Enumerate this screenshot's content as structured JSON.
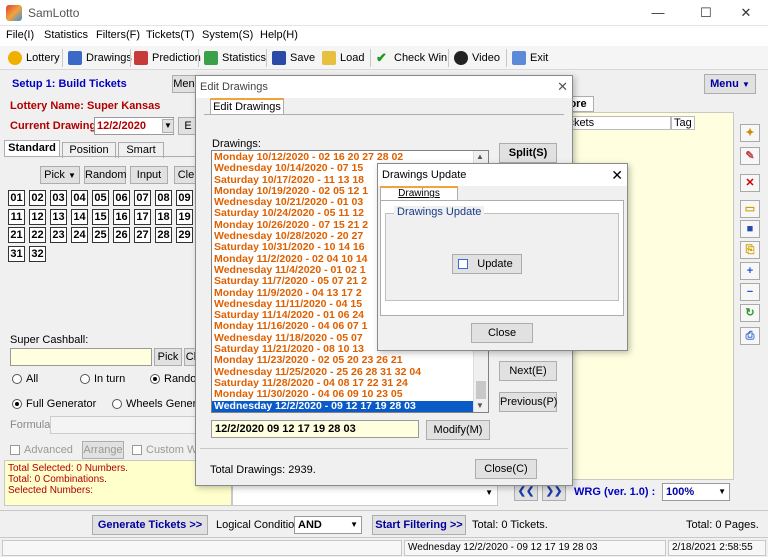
{
  "window": {
    "title": "SamLotto",
    "minimize": "—",
    "maximize": "☐",
    "close": "✕"
  },
  "menu": [
    "File(I)",
    "Statistics",
    "Filters(F)",
    "Tickets(T)",
    "System(S)",
    "Help(H)"
  ],
  "toolbar": [
    "Lottery",
    "Drawings",
    "Prediction",
    "Statistics",
    "Save",
    "Load",
    "Check Win",
    "Video",
    "Exit"
  ],
  "left": {
    "setup_label": "Setup 1: Build Tickets",
    "menu_btn": "Menu",
    "lottery_name": "Lottery Name: Super Kansas",
    "current_drawing_label": "Current Drawing:",
    "current_drawing_value": "12/2/2020",
    "tabs": [
      "Standard",
      "Position",
      "Smart"
    ],
    "buttons": [
      "Pick",
      "Random",
      "Input",
      "Cle"
    ],
    "numbers": [
      "01",
      "02",
      "03",
      "04",
      "05",
      "06",
      "07",
      "08",
      "09",
      "11",
      "12",
      "13",
      "14",
      "15",
      "16",
      "17",
      "18",
      "19",
      "21",
      "22",
      "23",
      "24",
      "25",
      "26",
      "27",
      "28",
      "29",
      "31",
      "32"
    ],
    "cashball_label": "Super Cashball:",
    "cashball_buttons": [
      "Pick",
      "Cl"
    ],
    "radio_row1": [
      "All",
      "In turn",
      "Random"
    ],
    "radio_row2": [
      "Full Generator",
      "Wheels Generato"
    ],
    "formula_label": "Formula:",
    "advanced_label": "Advanced",
    "arrange_label": "Arrange",
    "custom_label": "Custom Wh",
    "status_lines": [
      "Total Selected: 0 Numbers.",
      "Total: 0 Combinations.",
      "Selected Numbers:"
    ]
  },
  "right": {
    "menu_btn": "Menu",
    "tab_fragment": "ore",
    "col_tickets": "ickets",
    "col_tag": "Tag",
    "nav_prev": "❮❮",
    "nav_next": "❯❯",
    "wrg_label": "WRG (ver. 1.0) :",
    "zoom": "100%"
  },
  "edit_dialog": {
    "title": "Edit Drawings",
    "tab": "Edit Drawings",
    "drawings_label": "Drawings:",
    "rows": [
      "Monday 10/12/2020 - 02 16 20 27 28 02",
      "Wednesday 10/14/2020 - 07 15",
      "Saturday 10/17/2020 - 11 13 18",
      "Monday 10/19/2020 - 02 05 12 1",
      "Wednesday 10/21/2020 - 01 03",
      "Saturday 10/24/2020 - 05 11 12",
      "Monday 10/26/2020 - 07 15 21 2",
      "Wednesday 10/28/2020 - 20 27",
      "Saturday 10/31/2020 - 10 14 16",
      "Monday 11/2/2020 - 02 04 10 14",
      "Wednesday 11/4/2020 - 01 02 1",
      "Saturday 11/7/2020 - 05 07 21 2",
      "Monday 11/9/2020 - 04 13 17 2",
      "Wednesday 11/11/2020 - 04 15",
      "Saturday 11/14/2020 - 01 06 24",
      "Monday 11/16/2020 - 04 06 07 1",
      "Wednesday 11/18/2020 - 05 07",
      "Saturday 11/21/2020 - 08 10 13",
      "Monday 11/23/2020 - 02 05 20 23 26 21",
      "Wednesday 11/25/2020 - 25 26 28 31 32 04",
      "Saturday 11/28/2020 - 04 08 17 22 31 24",
      "Monday 11/30/2020 - 04 06 09 10 23 05",
      "Wednesday 12/2/2020 - 09 12 17 19 28 03"
    ],
    "split_btn": "Split(S)",
    "next_btn": "Next(E)",
    "previous_btn": "Previous(P)",
    "edit_value": "12/2/2020 09 12 17 19 28 03",
    "modify_btn": "Modify(M)",
    "total": "Total Drawings: 2939.",
    "close_btn": "Close(C)"
  },
  "update_dialog": {
    "title": "Drawings Update",
    "tab": "Drawings Update",
    "group": "Drawings Update",
    "update_btn": "Update",
    "close_btn": "Close"
  },
  "bottom": {
    "generate_btn": "Generate Tickets >>",
    "logical_label": "Logical Condition:",
    "logical_value": "AND",
    "filter_btn": "Start Filtering >>",
    "total_tickets": "Total: 0 Tickets.",
    "total_pages": "Total: 0 Pages."
  },
  "status": {
    "drawing": "Wednesday 12/2/2020 - 09 12 17 19 28 03",
    "datetime": "2/18/2021 2:58:55 PM"
  }
}
